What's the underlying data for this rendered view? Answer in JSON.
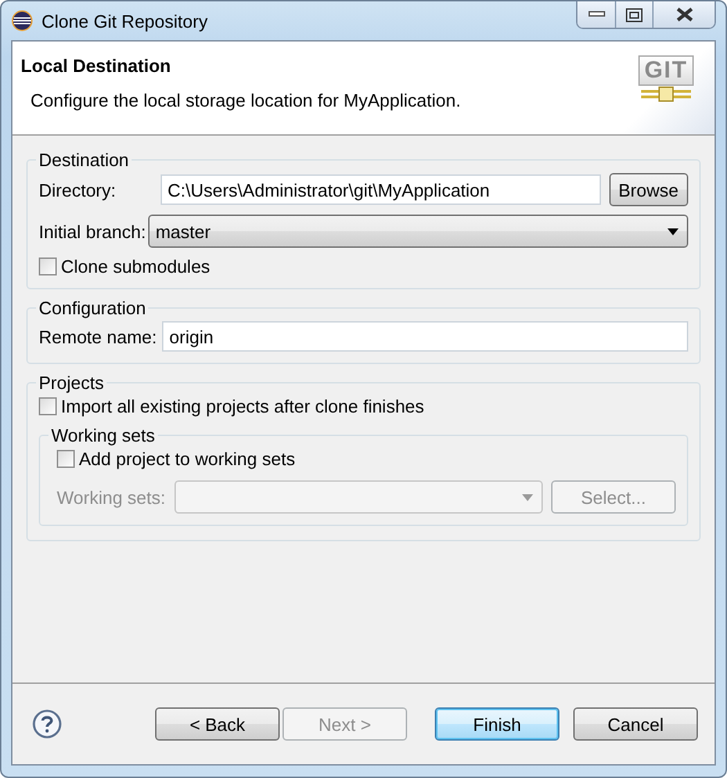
{
  "window": {
    "title": "Clone Git Repository"
  },
  "header": {
    "title": "Local Destination",
    "description": "Configure the local storage location for MyApplication.",
    "logo_text": "GIT"
  },
  "destination": {
    "title": "Destination",
    "directory": {
      "label": "Directory:",
      "value": "C:\\Users\\Administrator\\git\\MyApplication"
    },
    "browse_button": "Browse",
    "initial_branch": {
      "label": "Initial branch:",
      "value": "master"
    },
    "clone_submodules": {
      "label": "Clone submodules",
      "checked": false
    }
  },
  "configuration": {
    "title": "Configuration",
    "remote_name": {
      "label": "Remote name:",
      "value": "origin"
    }
  },
  "projects": {
    "title": "Projects",
    "import_all": {
      "label": "Import all existing projects after clone finishes",
      "checked": false
    },
    "working_sets": {
      "title": "Working sets",
      "add_to_working_sets": {
        "label": "Add project to working sets",
        "checked": false
      },
      "working_sets_field": {
        "label": "Working sets:",
        "disabled": true
      },
      "select_button": {
        "label": "Select...",
        "disabled": true
      }
    }
  },
  "buttons": [
    {
      "label": "< Back",
      "disabled": false,
      "default": false
    },
    {
      "label": "Next >",
      "disabled": true,
      "default": false
    },
    {
      "label": "Finish",
      "disabled": false,
      "default": true
    },
    {
      "label": "Cancel",
      "disabled": false,
      "default": false
    }
  ]
}
